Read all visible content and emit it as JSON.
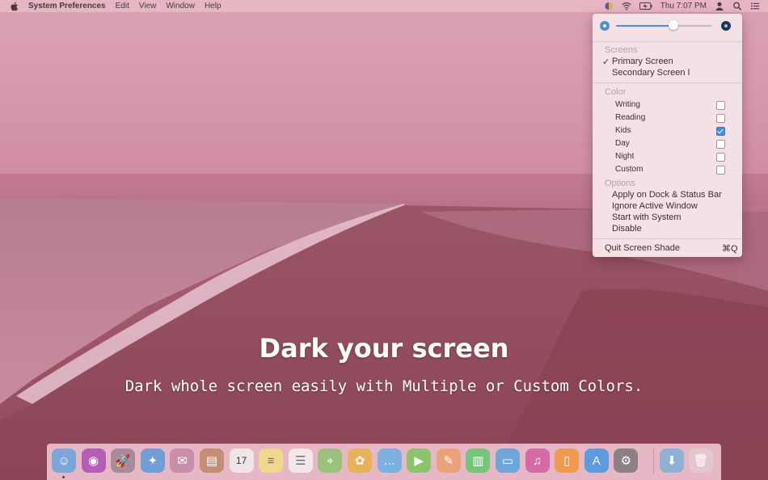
{
  "menubar": {
    "app_name": "System Preferences",
    "menus": [
      "Edit",
      "View",
      "Window",
      "Help"
    ],
    "clock": "Thu 7:07 PM",
    "icons": [
      "apple-icon",
      "screen-shade-icon",
      "wifi-icon",
      "battery-icon",
      "user-icon",
      "spotlight-icon",
      "notification-list-icon"
    ]
  },
  "tagline": {
    "headline": "Dark your screen",
    "subline": "Dark whole screen easily with Multiple or Custom Colors."
  },
  "dropdown": {
    "brightness": 0.6,
    "screens_header": "Screens",
    "screens": [
      {
        "label": "Primary Screen",
        "checked": true,
        "check_mark": "✓"
      },
      {
        "label": "Secondary Screen I",
        "checked": false
      }
    ],
    "color_header": "Color",
    "colors": [
      {
        "label": "Writing",
        "checked": false
      },
      {
        "label": "Reading",
        "checked": false
      },
      {
        "label": "Kids",
        "checked": true
      },
      {
        "label": "Day",
        "checked": false
      },
      {
        "label": "Night",
        "checked": false
      },
      {
        "label": "Custom",
        "checked": false
      }
    ],
    "options_header": "Options",
    "options": [
      "Apply on Dock & Status Bar",
      "Ignore Active Window",
      "Start with System",
      "Disable"
    ],
    "quit_label": "Quit Screen Shade",
    "quit_shortcut": "⌘Q"
  },
  "dock": {
    "apps": [
      {
        "name": "finder-icon",
        "color": "#7aa7d8",
        "glyph": "☺"
      },
      {
        "name": "siri-icon",
        "color": "#b45fb5",
        "glyph": "◉"
      },
      {
        "name": "launchpad-icon",
        "color": "#a88a9a",
        "glyph": "🚀"
      },
      {
        "name": "safari-icon",
        "color": "#6f9fd6",
        "glyph": "✦"
      },
      {
        "name": "mail-icon",
        "color": "#c98fa9",
        "glyph": "✉"
      },
      {
        "name": "contacts-icon",
        "color": "#c48d74",
        "glyph": "▤"
      },
      {
        "name": "calendar-icon",
        "color": "#f1e5e8",
        "glyph": "17"
      },
      {
        "name": "notes-icon",
        "color": "#f0d98c",
        "glyph": "≡"
      },
      {
        "name": "reminders-icon",
        "color": "#f2e8ec",
        "glyph": "☰"
      },
      {
        "name": "maps-icon",
        "color": "#9bc27a",
        "glyph": "⌖"
      },
      {
        "name": "photos-icon",
        "color": "#e9b15a",
        "glyph": "✿"
      },
      {
        "name": "messages-icon",
        "color": "#7db2e0",
        "glyph": "…"
      },
      {
        "name": "facetime-icon",
        "color": "#8cc46d",
        "glyph": "▶"
      },
      {
        "name": "pages-icon",
        "color": "#e9a27a",
        "glyph": "✎"
      },
      {
        "name": "numbers-icon",
        "color": "#74c67a",
        "glyph": "▥"
      },
      {
        "name": "keynote-icon",
        "color": "#6fa6da",
        "glyph": "▭"
      },
      {
        "name": "itunes-icon",
        "color": "#d56aa9",
        "glyph": "♫"
      },
      {
        "name": "ibooks-icon",
        "color": "#ef9a4f",
        "glyph": "▯"
      },
      {
        "name": "app-store-icon",
        "color": "#5c9be0",
        "glyph": "A"
      },
      {
        "name": "system-preferences-icon",
        "color": "#8e7f86",
        "glyph": "⚙"
      },
      {
        "name": "downloads-folder-icon",
        "color": "#8fb1d6",
        "glyph": "⬇"
      },
      {
        "name": "trash-icon",
        "color": "#e5c5ce",
        "glyph": "🗑"
      }
    ]
  }
}
